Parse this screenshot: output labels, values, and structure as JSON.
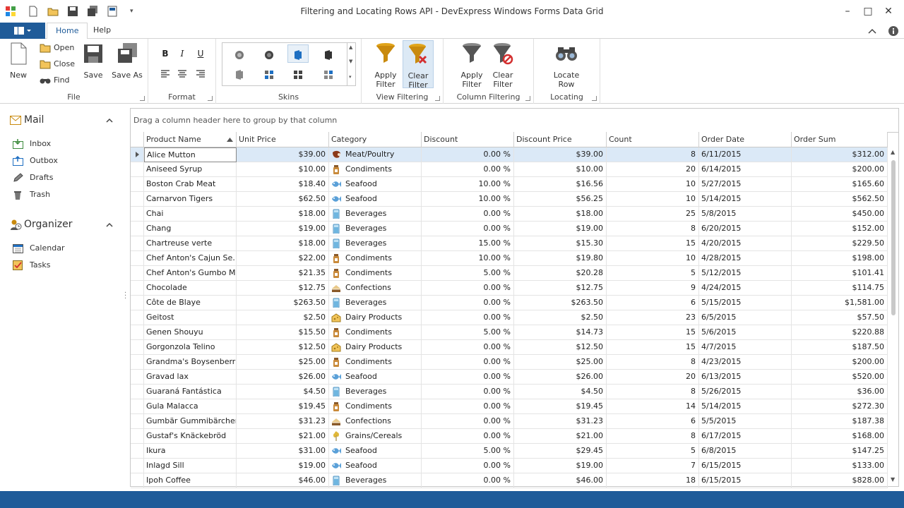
{
  "window": {
    "title": "Filtering and Locating Rows API - DevExpress Windows Forms Data Grid"
  },
  "tabs": [
    {
      "label": "Home"
    },
    {
      "label": "Help"
    }
  ],
  "ribbon": {
    "file": {
      "new": "New",
      "open": "Open",
      "close": "Close",
      "find": "Find",
      "save": "Save",
      "save_as": "Save As",
      "caption": "File"
    },
    "format": {
      "caption": "Format",
      "bold": "B",
      "italic": "I",
      "underline": "U"
    },
    "skins": {
      "caption": "Skins"
    },
    "view_filtering": {
      "apply": "Apply Filter",
      "clear": "Clear Filter",
      "caption": "View Filtering"
    },
    "column_filtering": {
      "apply": "Apply Filter",
      "clear": "Clear Filter",
      "caption": "Column Filtering"
    },
    "locating": {
      "locate": "Locate Row",
      "caption": "Locating"
    }
  },
  "sidebar": {
    "mail": {
      "title": "Mail",
      "items": [
        {
          "label": "Inbox"
        },
        {
          "label": "Outbox"
        },
        {
          "label": "Drafts"
        },
        {
          "label": "Trash"
        }
      ]
    },
    "organizer": {
      "title": "Organizer",
      "items": [
        {
          "label": "Calendar"
        },
        {
          "label": "Tasks"
        }
      ]
    }
  },
  "grid": {
    "group_panel_text": "Drag a column header here to group by that column",
    "columns": [
      "Product Name",
      "Unit Price",
      "Category",
      "Discount",
      "Discount Price",
      "Count",
      "Order Date",
      "Order Sum"
    ],
    "rows": [
      [
        "Alice Mutton",
        "$39.00",
        "Meat/Poultry",
        "0.00 %",
        "$39.00",
        "8",
        "6/11/2015",
        "$312.00"
      ],
      [
        "Aniseed Syrup",
        "$10.00",
        "Condiments",
        "0.00 %",
        "$10.00",
        "20",
        "6/14/2015",
        "$200.00"
      ],
      [
        "Boston Crab Meat",
        "$18.40",
        "Seafood",
        "10.00 %",
        "$16.56",
        "10",
        "5/27/2015",
        "$165.60"
      ],
      [
        "Carnarvon Tigers",
        "$62.50",
        "Seafood",
        "10.00 %",
        "$56.25",
        "10",
        "5/14/2015",
        "$562.50"
      ],
      [
        "Chai",
        "$18.00",
        "Beverages",
        "0.00 %",
        "$18.00",
        "25",
        "5/8/2015",
        "$450.00"
      ],
      [
        "Chang",
        "$19.00",
        "Beverages",
        "0.00 %",
        "$19.00",
        "8",
        "6/20/2015",
        "$152.00"
      ],
      [
        "Chartreuse verte",
        "$18.00",
        "Beverages",
        "15.00 %",
        "$15.30",
        "15",
        "4/20/2015",
        "$229.50"
      ],
      [
        "Chef Anton's Cajun Se…",
        "$22.00",
        "Condiments",
        "10.00 %",
        "$19.80",
        "10",
        "4/28/2015",
        "$198.00"
      ],
      [
        "Chef Anton's Gumbo Mix",
        "$21.35",
        "Condiments",
        "5.00 %",
        "$20.28",
        "5",
        "5/12/2015",
        "$101.41"
      ],
      [
        "Chocolade",
        "$12.75",
        "Confections",
        "0.00 %",
        "$12.75",
        "9",
        "4/24/2015",
        "$114.75"
      ],
      [
        "Côte de Blaye",
        "$263.50",
        "Beverages",
        "0.00 %",
        "$263.50",
        "6",
        "5/15/2015",
        "$1,581.00"
      ],
      [
        "Geitost",
        "$2.50",
        "Dairy Products",
        "0.00 %",
        "$2.50",
        "23",
        "6/5/2015",
        "$57.50"
      ],
      [
        "Genen Shouyu",
        "$15.50",
        "Condiments",
        "5.00 %",
        "$14.73",
        "15",
        "5/6/2015",
        "$220.88"
      ],
      [
        "Gorgonzola Telino",
        "$12.50",
        "Dairy Products",
        "0.00 %",
        "$12.50",
        "15",
        "4/7/2015",
        "$187.50"
      ],
      [
        "Grandma's Boysenberr…",
        "$25.00",
        "Condiments",
        "0.00 %",
        "$25.00",
        "8",
        "4/23/2015",
        "$200.00"
      ],
      [
        "Gravad lax",
        "$26.00",
        "Seafood",
        "0.00 %",
        "$26.00",
        "20",
        "6/13/2015",
        "$520.00"
      ],
      [
        "Guaraná Fantástica",
        "$4.50",
        "Beverages",
        "0.00 %",
        "$4.50",
        "8",
        "5/26/2015",
        "$36.00"
      ],
      [
        "Gula Malacca",
        "$19.45",
        "Condiments",
        "0.00 %",
        "$19.45",
        "14",
        "5/14/2015",
        "$272.30"
      ],
      [
        "Gumbär Gummibärchen",
        "$31.23",
        "Confections",
        "0.00 %",
        "$31.23",
        "6",
        "5/5/2015",
        "$187.38"
      ],
      [
        "Gustaf's Knäckebröd",
        "$21.00",
        "Grains/Cereals",
        "0.00 %",
        "$21.00",
        "8",
        "6/17/2015",
        "$168.00"
      ],
      [
        "Ikura",
        "$31.00",
        "Seafood",
        "5.00 %",
        "$29.45",
        "5",
        "6/8/2015",
        "$147.25"
      ],
      [
        "Inlagd Sill",
        "$19.00",
        "Seafood",
        "0.00 %",
        "$19.00",
        "7",
        "6/15/2015",
        "$133.00"
      ],
      [
        "Ipoh Coffee",
        "$46.00",
        "Beverages",
        "0.00 %",
        "$46.00",
        "18",
        "6/15/2015",
        "$828.00"
      ]
    ]
  },
  "colors": {
    "accent": "#1f5b99",
    "selected_row": "#dbe9f7"
  }
}
